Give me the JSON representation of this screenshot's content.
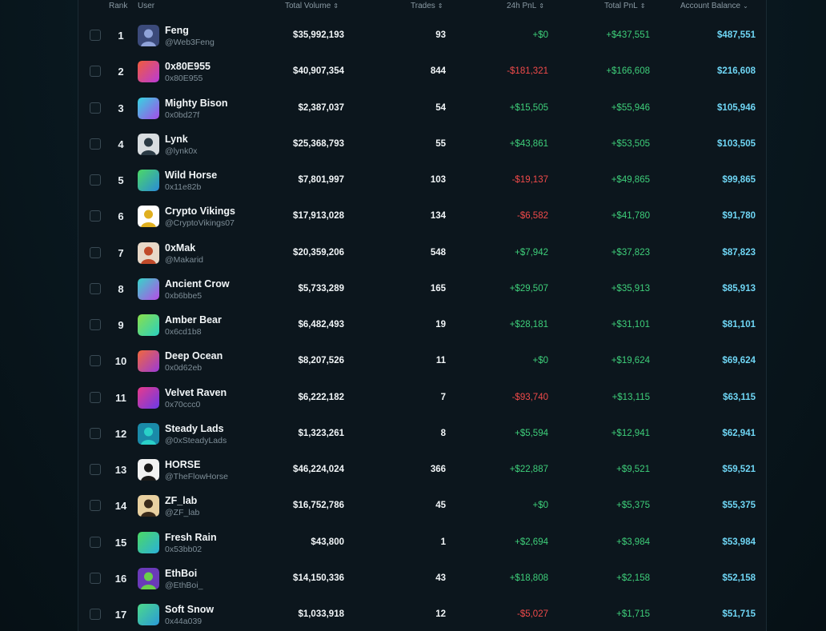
{
  "header": {
    "rank": "Rank",
    "user": "User",
    "total_volume": "Total Volume",
    "trades": "Trades",
    "pnl_24h": "24h PnL",
    "total_pnl": "Total PnL",
    "account_balance": "Account Balance",
    "sort_icon": "sort-updown-icon",
    "sort_desc_icon": "chevron-down-icon"
  },
  "colors": {
    "positive": "#3ecf7a",
    "negative": "#f04a4a",
    "balance": "#6fd6f5"
  },
  "rows": [
    {
      "rank": "1",
      "name": "Feng",
      "handle": "@Web3Feng",
      "avatar": "photo-avatar",
      "avatar_colors": [
        "#3b4a7a",
        "#8fa3d9"
      ],
      "volume": "$35,992,193",
      "trades": "93",
      "pnl24": "+$0",
      "pnl24_sign": "zero",
      "total_pnl": "+$437,551",
      "balance": "$487,551"
    },
    {
      "rank": "2",
      "name": "0x80E955",
      "handle": "0x80E955",
      "avatar": "gradient-avatar",
      "avatar_colors": [
        "#f25c3b",
        "#b83ad9"
      ],
      "volume": "$40,907,354",
      "trades": "844",
      "pnl24": "-$181,321",
      "pnl24_sign": "neg",
      "total_pnl": "+$166,608",
      "balance": "$216,608"
    },
    {
      "rank": "3",
      "name": "Mighty Bison",
      "handle": "0x0bd27f",
      "avatar": "gradient-avatar",
      "avatar_colors": [
        "#34d6e0",
        "#a64be8"
      ],
      "volume": "$2,387,037",
      "trades": "54",
      "pnl24": "+$15,505",
      "pnl24_sign": "pos",
      "total_pnl": "+$55,946",
      "balance": "$105,946"
    },
    {
      "rank": "4",
      "name": "Lynk",
      "handle": "@lynk0x",
      "avatar": "photo-avatar",
      "avatar_colors": [
        "#d8dde0",
        "#2a3a44"
      ],
      "volume": "$25,368,793",
      "trades": "55",
      "pnl24": "+$43,861",
      "pnl24_sign": "pos",
      "total_pnl": "+$53,505",
      "balance": "$103,505"
    },
    {
      "rank": "5",
      "name": "Wild Horse",
      "handle": "0x11e82b",
      "avatar": "gradient-avatar",
      "avatar_colors": [
        "#4cd964",
        "#2a8ad9"
      ],
      "volume": "$7,801,997",
      "trades": "103",
      "pnl24": "-$19,137",
      "pnl24_sign": "neg",
      "total_pnl": "+$49,865",
      "balance": "$99,865"
    },
    {
      "rank": "6",
      "name": "Crypto Vikings",
      "handle": "@CryptoVikings07",
      "avatar": "photo-avatar",
      "avatar_colors": [
        "#ffffff",
        "#e0b020"
      ],
      "volume": "$17,913,028",
      "trades": "134",
      "pnl24": "-$6,582",
      "pnl24_sign": "neg",
      "total_pnl": "+$41,780",
      "balance": "$91,780"
    },
    {
      "rank": "7",
      "name": "0xMak",
      "handle": "@Makarid",
      "avatar": "photo-avatar",
      "avatar_colors": [
        "#e8d8c8",
        "#c04a2a"
      ],
      "volume": "$20,359,206",
      "trades": "548",
      "pnl24": "+$7,942",
      "pnl24_sign": "pos",
      "total_pnl": "+$37,823",
      "balance": "$87,823"
    },
    {
      "rank": "8",
      "name": "Ancient Crow",
      "handle": "0xb6bbe5",
      "avatar": "gradient-avatar",
      "avatar_colors": [
        "#34d6c8",
        "#b84be8"
      ],
      "volume": "$5,733,289",
      "trades": "165",
      "pnl24": "+$29,507",
      "pnl24_sign": "pos",
      "total_pnl": "+$35,913",
      "balance": "$85,913"
    },
    {
      "rank": "9",
      "name": "Amber Bear",
      "handle": "0x6cd1b8",
      "avatar": "gradient-avatar",
      "avatar_colors": [
        "#8ae04a",
        "#2ad0c0"
      ],
      "volume": "$6,482,493",
      "trades": "19",
      "pnl24": "+$28,181",
      "pnl24_sign": "pos",
      "total_pnl": "+$31,101",
      "balance": "$81,101"
    },
    {
      "rank": "10",
      "name": "Deep Ocean",
      "handle": "0x0d62eb",
      "avatar": "gradient-avatar",
      "avatar_colors": [
        "#f2683b",
        "#9a3ad9"
      ],
      "volume": "$8,207,526",
      "trades": "11",
      "pnl24": "+$0",
      "pnl24_sign": "zero",
      "total_pnl": "+$19,624",
      "balance": "$69,624"
    },
    {
      "rank": "11",
      "name": "Velvet Raven",
      "handle": "0x70ccc0",
      "avatar": "gradient-avatar",
      "avatar_colors": [
        "#e83a8a",
        "#6a3ae8"
      ],
      "volume": "$6,222,182",
      "trades": "7",
      "pnl24": "-$93,740",
      "pnl24_sign": "neg",
      "total_pnl": "+$13,115",
      "balance": "$63,115"
    },
    {
      "rank": "12",
      "name": "Steady Lads",
      "handle": "@0xSteadyLads",
      "avatar": "photo-avatar",
      "avatar_colors": [
        "#1a8aa8",
        "#2ad0c8"
      ],
      "volume": "$1,323,261",
      "trades": "8",
      "pnl24": "+$5,594",
      "pnl24_sign": "pos",
      "total_pnl": "+$12,941",
      "balance": "$62,941"
    },
    {
      "rank": "13",
      "name": "HORSE",
      "handle": "@TheFlowHorse",
      "avatar": "photo-avatar",
      "avatar_colors": [
        "#f2f2f2",
        "#1a1a1a"
      ],
      "volume": "$46,224,024",
      "trades": "366",
      "pnl24": "+$22,887",
      "pnl24_sign": "pos",
      "total_pnl": "+$9,521",
      "balance": "$59,521"
    },
    {
      "rank": "14",
      "name": "ZF_lab",
      "handle": "@ZF_lab",
      "avatar": "photo-avatar",
      "avatar_colors": [
        "#e8d0a0",
        "#3a2a1a"
      ],
      "volume": "$16,752,786",
      "trades": "45",
      "pnl24": "+$0",
      "pnl24_sign": "zero",
      "total_pnl": "+$5,375",
      "balance": "$55,375"
    },
    {
      "rank": "15",
      "name": "Fresh Rain",
      "handle": "0x53bb02",
      "avatar": "gradient-avatar",
      "avatar_colors": [
        "#4cd964",
        "#2ab0d9"
      ],
      "volume": "$43,800",
      "trades": "1",
      "pnl24": "+$2,694",
      "pnl24_sign": "pos",
      "total_pnl": "+$3,984",
      "balance": "$53,984"
    },
    {
      "rank": "16",
      "name": "EthBoi",
      "handle": "@EthBoi_",
      "avatar": "photo-avatar",
      "avatar_colors": [
        "#6a3ab8",
        "#6ad04a"
      ],
      "volume": "$14,150,336",
      "trades": "43",
      "pnl24": "+$18,808",
      "pnl24_sign": "pos",
      "total_pnl": "+$2,158",
      "balance": "$52,158"
    },
    {
      "rank": "17",
      "name": "Soft Snow",
      "handle": "0x44a039",
      "avatar": "gradient-avatar",
      "avatar_colors": [
        "#4cd98a",
        "#2a9ad9"
      ],
      "volume": "$1,033,918",
      "trades": "12",
      "pnl24": "-$5,027",
      "pnl24_sign": "neg",
      "total_pnl": "+$1,715",
      "balance": "$51,715"
    }
  ]
}
